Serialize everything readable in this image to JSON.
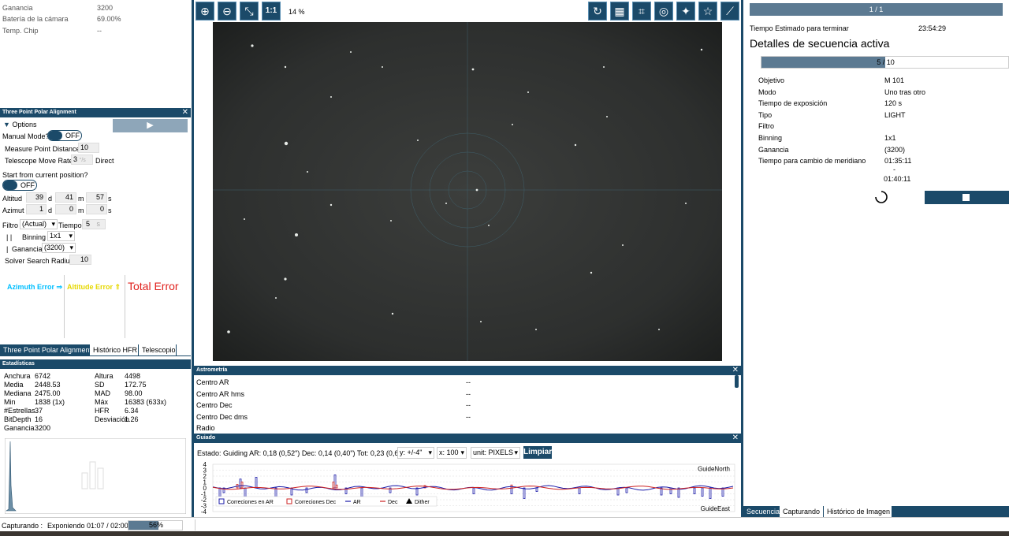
{
  "camera_info": {
    "rows": [
      {
        "label": "Ganancia",
        "value": "3200"
      },
      {
        "label": "Batería de la cámara",
        "value": "69.00%"
      },
      {
        "label": "Temp. Chip",
        "value": "--"
      }
    ]
  },
  "tppa": {
    "title": "Three Point Polar Alignment",
    "options_label": "Options",
    "manual_mode_label": "Manual Mode?",
    "manual_mode_value": "OFF",
    "measure_point_distance_label": "Measure Point Distance",
    "measure_point_distance_value": "10",
    "telescope_move_rate_label": "Telescope Move Rate",
    "telescope_move_rate_value": "3",
    "telescope_move_rate_unit": "°/s",
    "direction_label": "Direct",
    "start_from_current_label": "Start from current position?",
    "start_from_current_value": "OFF",
    "altitude_label": "Altitud",
    "altitude_d": "39",
    "altitude_m": "41",
    "altitude_s": "57",
    "azimuth_label": "Azimut",
    "azimuth_d": "1",
    "azimuth_m": "0",
    "azimuth_s": "0",
    "unit_d": "d",
    "unit_m": "m",
    "unit_s": "s",
    "filter_label": "Filtro",
    "filter_value": "(Actual)",
    "time_label": "Tiempo",
    "time_value": "5",
    "time_unit": "s",
    "binning_prefix": "|   |",
    "binning_label": "Binning",
    "binning_value": "1x1",
    "gain_prefix": "|",
    "gain_label": "Ganancia",
    "gain_value": "(3200)",
    "solver_radius_label": "Solver Search Radius",
    "solver_radius_value": "10",
    "azimuth_error_label": "Azimuth Error ⇒",
    "altitude_error_label": "Altitude Error ⇑",
    "total_error_label": "Total Error",
    "azimuth_error_color": "#00bfff",
    "altitude_error_color": "#e6d800",
    "total_error_color": "#e0201c"
  },
  "left_tabs": [
    {
      "label": "Three Point Polar Alignment",
      "active": true
    },
    {
      "label": "Histórico HFR",
      "active": false
    },
    {
      "label": "Telescopio",
      "active": false
    }
  ],
  "stats": {
    "title": "Estadísticas",
    "left": [
      {
        "label": "Anchura",
        "value": "6742"
      },
      {
        "label": "Media",
        "value": "2448.53"
      },
      {
        "label": "Mediana",
        "value": "2475.00"
      },
      {
        "label": "Min",
        "value": "1838 (1x)"
      },
      {
        "label": "#Estrellas",
        "value": "37"
      },
      {
        "label": "BitDepth",
        "value": "16"
      },
      {
        "label": "Ganancia",
        "value": "3200"
      }
    ],
    "right": [
      {
        "label": "Altura",
        "value": "4498"
      },
      {
        "label": "SD",
        "value": "172.75"
      },
      {
        "label": "MAD",
        "value": "98.00"
      },
      {
        "label": "Máx",
        "value": "16383 (633x)"
      },
      {
        "label": "HFR",
        "value": "6.34"
      },
      {
        "label": "Desviación",
        "value": "1.26"
      }
    ]
  },
  "image_toolbar": {
    "zoom_in_icon": "zoom-in-icon",
    "zoom_out_icon": "zoom-out-icon",
    "fit_icon": "fit-to-window-icon",
    "one_to_one_label": "1:1",
    "zoom_value": "14 %",
    "right_icons": [
      "rotate-icon",
      "grid-icon",
      "crosshair-frame-icon",
      "target-icon",
      "magic-wand-icon",
      "star-icon",
      "telescope-icon"
    ]
  },
  "astrometry": {
    "title": "Astrometría",
    "rows": [
      {
        "label": "Centro AR",
        "value": "--"
      },
      {
        "label": "Centro AR hms",
        "value": "--"
      },
      {
        "label": "Centro Dec",
        "value": "--"
      },
      {
        "label": "Centro Dec dms",
        "value": "--"
      },
      {
        "label": "Radio",
        "value": ""
      }
    ]
  },
  "guiding": {
    "title": "Guiado",
    "status_label": "Estado: Guiding",
    "ar_value": "AR: 0,18 (0,52\")",
    "dec_value": "Dec: 0,14 (0,40\")",
    "tot_value": "Tot: 0,23 (0,66\")",
    "y_select": "y: +/-4\"",
    "x_select": "x: 100",
    "unit_select": "unit: PIXELS",
    "clear_button": "Limpiar",
    "guide_north": "GuideNorth",
    "guide_east": "GuideEast",
    "y_ticks": [
      "4",
      "3",
      "2",
      "1",
      "0",
      "-1",
      "-2",
      "-3",
      "-4"
    ],
    "legend": [
      {
        "label": "Correciones en AR",
        "color": "#1a1aa8"
      },
      {
        "label": "Correciones Dec",
        "color": "#cc2222"
      },
      {
        "label": "AR",
        "color": "#1a1aa8"
      },
      {
        "label": "Dec",
        "color": "#cc2222"
      },
      {
        "label": "Dither",
        "color": "#000000"
      }
    ]
  },
  "sequence": {
    "top_progress_label": "1 / 1",
    "eta_label": "Tiempo Estimado para terminar",
    "eta_value": "23:54:29",
    "heading": "Detalles de secuencia activa",
    "progress_label": "5 / 10",
    "progress_fraction": 0.5,
    "rows": [
      {
        "label": "Objetivo",
        "value": "M 101"
      },
      {
        "label": "Modo",
        "value": "Uno tras otro"
      },
      {
        "label": "Tiempo de exposición",
        "value": "120 s"
      },
      {
        "label": "Tipo",
        "value": "LIGHT"
      },
      {
        "label": "Filtro",
        "value": ""
      },
      {
        "label": "Binning",
        "value": "1x1"
      },
      {
        "label": "Ganancia",
        "value": "(3200)"
      },
      {
        "label": "Tiempo para cambio de meridiano",
        "value": "01:35:11"
      }
    ],
    "dash": "-",
    "meridian_second": "01:40:11"
  },
  "right_tabs": [
    {
      "label": "Secuencia",
      "active": true
    },
    {
      "label": "Capturando",
      "active": false
    },
    {
      "label": "Histórico de Imagen",
      "active": false
    }
  ],
  "status_bar": {
    "label": "Capturando :",
    "text": "Exponiendo 01:07 / 02:00",
    "progress_label": "56%",
    "progress_fraction": 0.56
  },
  "colors": {
    "accent": "#1b4a69",
    "image_bg": "#2f3130"
  }
}
